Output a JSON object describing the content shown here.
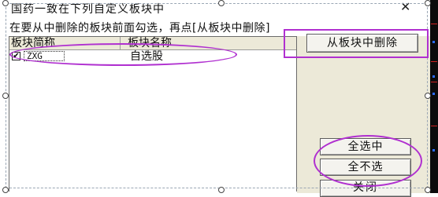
{
  "dialog": {
    "title": "国药一致在下列自定义板块中",
    "close_glyph": "✕",
    "instruction": "在要从中删除的板块前面勾选，再点[从板块中删除]"
  },
  "list": {
    "columns": [
      "板块简称",
      "板块名称"
    ],
    "rows": [
      {
        "checked": true,
        "check_glyph": "✔",
        "code": "ZXG",
        "name": "自选股"
      }
    ]
  },
  "buttons": {
    "remove": "从板块中删除",
    "select_all": "全选中",
    "select_none": "全不选",
    "close": "关闭"
  },
  "colors": {
    "annotation": "#b030d0",
    "panel_bg": "#ece9d8",
    "button_bg": "#f4f3ee"
  }
}
